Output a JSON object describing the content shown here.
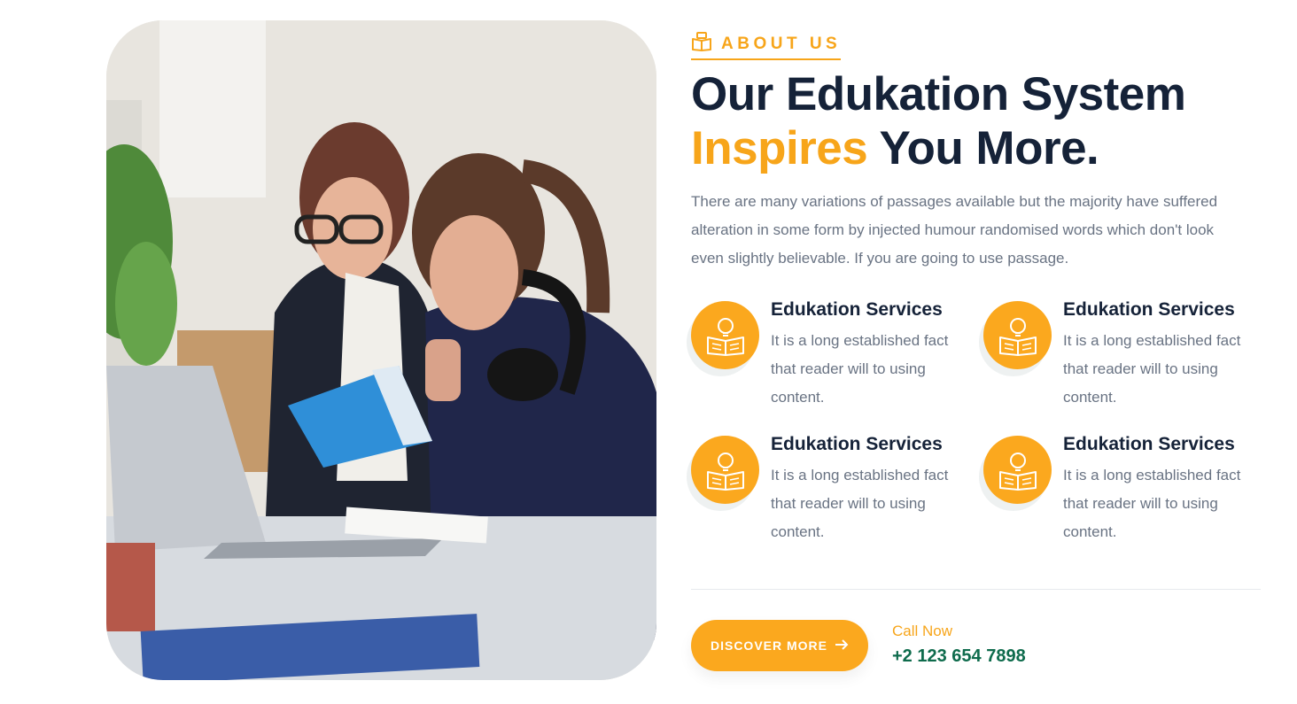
{
  "section": {
    "eyebrow": {
      "icon": "book-icon",
      "label": "ABOUT US"
    },
    "title": {
      "line1": "Our Edukation System",
      "accent": "Inspires",
      "rest": " You More."
    },
    "description": "There are many variations of passages available but the majority have suffered alteration in some form by injected humour randomised words which don't look even slightly believable. If you are going to use passage.",
    "features": [
      {
        "icon": "lightbulb-book-icon",
        "title": "Edukation Services",
        "text": "It is a long established fact that reader will to using content."
      },
      {
        "icon": "lightbulb-book-icon",
        "title": "Edukation Services",
        "text": "It is a long established fact that reader will to using content."
      },
      {
        "icon": "lightbulb-book-icon",
        "title": "Edukation Services",
        "text": "It is a long established fact that reader will to using content."
      },
      {
        "icon": "lightbulb-book-icon",
        "title": "Edukation Services",
        "text": "It is a long established fact that reader will to using content."
      }
    ],
    "cta": {
      "label": "DISCOVER MORE",
      "icon": "arrow-right-icon"
    },
    "call": {
      "label": "Call Now",
      "number": "+2 123 654 7898"
    }
  },
  "colors": {
    "accent": "#f7a51a",
    "heading": "#152238",
    "body_text": "#697383",
    "phone": "#0e6b4c",
    "button": "#fba81e"
  }
}
